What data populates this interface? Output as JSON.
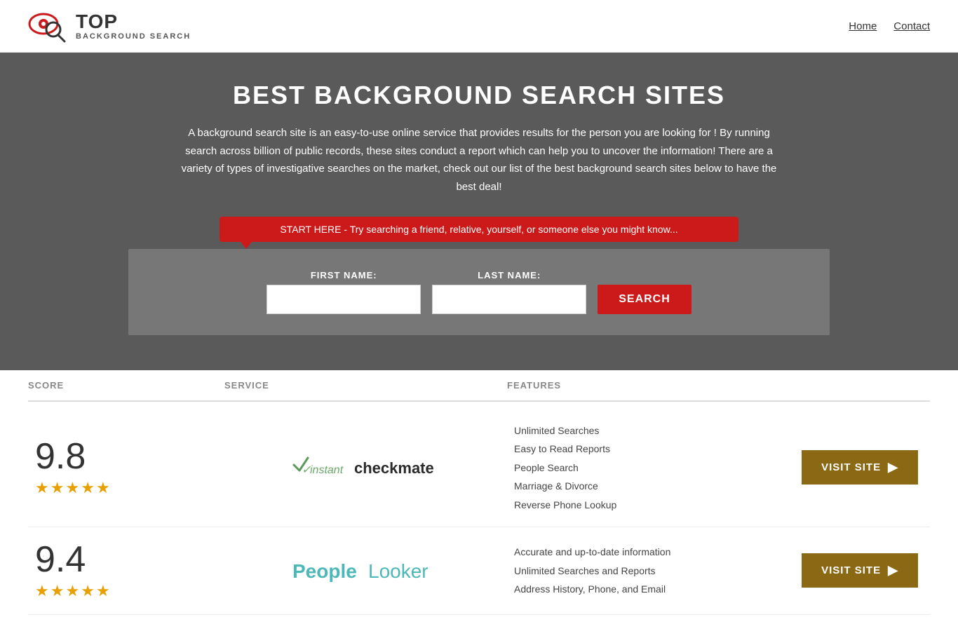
{
  "header": {
    "logo_top": "TOP",
    "logo_sub": "BACKGROUND SEARCH",
    "nav": {
      "home": "Home",
      "contact": "Contact"
    }
  },
  "hero": {
    "title": "BEST BACKGROUND SEARCH SITES",
    "description": "A background search site is an easy-to-use online service that provides results  for the person you are looking for ! By  running  search across billion of public records, these sites conduct  a report which can help you to uncover the information! There are a variety of types of investigative searches on the market, check out our  list of the best background search sites below to have the best deal!",
    "bubble_text": "START HERE - Try searching a friend, relative, yourself, or someone else you might know...",
    "first_name_label": "FIRST NAME:",
    "last_name_label": "LAST NAME:",
    "search_button": "SEARCH"
  },
  "results": {
    "columns": {
      "score": "SCORE",
      "service": "SERVICE",
      "features": "FEATURES",
      "action": ""
    },
    "rows": [
      {
        "id": "row1",
        "score": "9.8",
        "stars": 4.5,
        "service_name": "Instant Checkmate",
        "service_logo_type": "checkmate",
        "features": [
          "Unlimited Searches",
          "Easy to Read Reports",
          "People Search",
          "Marriage & Divorce",
          "Reverse Phone Lookup"
        ],
        "visit_label": "VISIT SITE"
      },
      {
        "id": "row2",
        "score": "9.4",
        "stars": 4.5,
        "service_name": "PeopleLooker",
        "service_logo_type": "peoplelooker",
        "features": [
          "Accurate and up-to-date information",
          "Unlimited Searches and Reports",
          "Address History, Phone, and Email"
        ],
        "visit_label": "VISIT SITE"
      }
    ]
  }
}
